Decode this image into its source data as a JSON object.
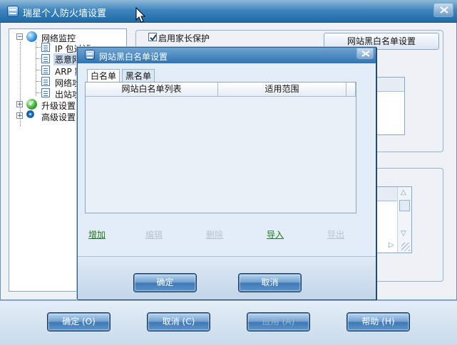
{
  "window": {
    "title": "瑞星个人防火墙设置"
  },
  "tree": {
    "items": [
      {
        "label": "网络监控",
        "icon": "globe-icon"
      },
      {
        "label": "IP 包过滤",
        "icon": "document-icon"
      },
      {
        "label": "恶意网",
        "icon": "document-icon"
      },
      {
        "label": "ARP 欺",
        "icon": "document-icon"
      },
      {
        "label": "网络攻",
        "icon": "document-icon"
      },
      {
        "label": "出站攻",
        "icon": "document-icon"
      },
      {
        "label": "升级设置",
        "icon": "check-globe-icon"
      },
      {
        "label": "高级设置",
        "icon": "gear-icon"
      }
    ],
    "expander_plus": "+",
    "expander_minus": "−"
  },
  "settings": {
    "parental_control_label": "启用家长保护",
    "parental_control_checked": true,
    "blacklist_button": "网站黑白名单设置"
  },
  "dialog": {
    "title": "网站黑白名单设置",
    "tabs": [
      {
        "label": "白名单",
        "active": true
      },
      {
        "label": "黑名单",
        "active": false
      }
    ],
    "columns": [
      "网站白名单列表",
      "适用范围"
    ],
    "actions": [
      {
        "label": "增加",
        "enabled": true
      },
      {
        "label": "编辑",
        "enabled": false
      },
      {
        "label": "删除",
        "enabled": false
      },
      {
        "label": "导入",
        "enabled": true
      },
      {
        "label": "导出",
        "enabled": false
      }
    ],
    "ok_label": "确定",
    "cancel_label": "取消"
  },
  "footer": {
    "ok_label": "确定 (O)",
    "cancel_label": "取消 (C)",
    "apply_label": "应用 (A)",
    "apply_enabled": false,
    "help_label": "帮助 (H)"
  },
  "colors": {
    "titlebar": "#3f86bf",
    "button": "#5b93cb",
    "enabled_link": "#1e7a1e",
    "disabled_link": "#b8c4cf"
  }
}
